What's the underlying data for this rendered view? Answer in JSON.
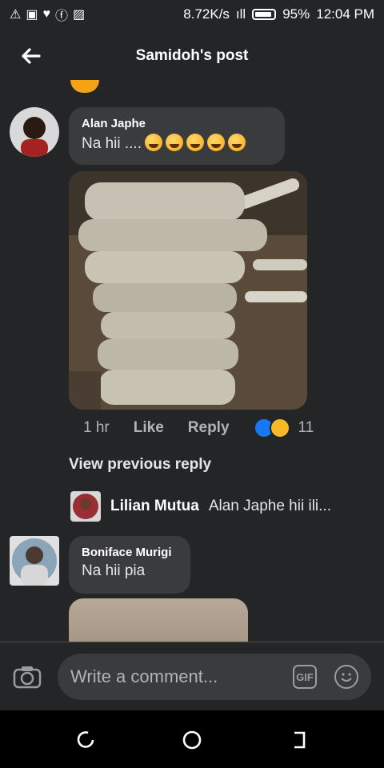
{
  "status_bar": {
    "speed": "8.72K/s",
    "battery": "95%",
    "time": "12:04 PM",
    "icons": [
      "warning-icon",
      "news-icon",
      "twitter-icon",
      "facebook-icon",
      "image-icon",
      "signal-icon",
      "battery-icon"
    ]
  },
  "header": {
    "title": "Samidoh's post"
  },
  "comments": [
    {
      "author": "Alan Japhe",
      "text": "Na hii ....",
      "time": "1 hr",
      "like_label": "Like",
      "reply_label": "Reply",
      "reaction_count": "11"
    },
    {
      "author": "Boniface Murigi",
      "text": "Na hii pia"
    }
  ],
  "view_previous": "View previous reply",
  "reply_preview": {
    "name": "Lilian Mutua",
    "snippet": "Alan Japhe hii ili..."
  },
  "composer": {
    "placeholder": "Write a comment...",
    "gif_label": "GIF"
  },
  "colors": {
    "background": "#242526",
    "bubble": "#3a3b3c",
    "like_blue": "#1877f2",
    "haha_yellow": "#f7b928"
  }
}
